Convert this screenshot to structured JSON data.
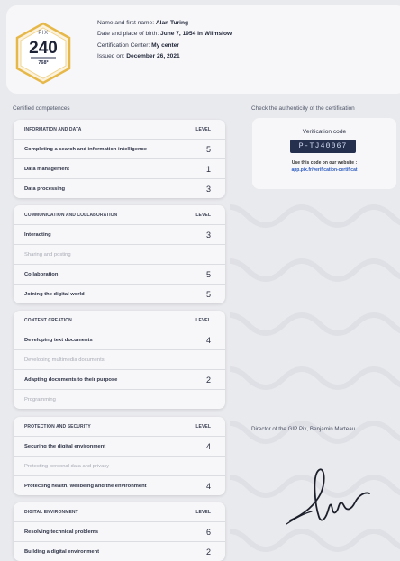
{
  "badge": {
    "brand": "PIX",
    "score": "240",
    "max": "768*"
  },
  "identity": [
    {
      "label": "Name and first name:",
      "value": "Alan Turing"
    },
    {
      "label": "Date and place of birth:",
      "value": "June 7, 1954 in Wilmslow"
    },
    {
      "label": "Certification Center:",
      "value": "My center"
    },
    {
      "label": "Issued on:",
      "value": "December 26, 2021"
    }
  ],
  "competences_title": "Certified competences",
  "authenticity_title": "Check the authenticity of the certification",
  "verification": {
    "title": "Verification code",
    "code": "P-TJ40067",
    "note": "Use this code on our website :",
    "url": "app.pix.fr/verification-certificat"
  },
  "level_label": "LEVEL",
  "groups": [
    {
      "title": "INFORMATION AND DATA",
      "rows": [
        {
          "name": "Completing a search and information intelligence",
          "level": "5"
        },
        {
          "name": "Data management",
          "level": "1"
        },
        {
          "name": "Data processing",
          "level": "3"
        }
      ]
    },
    {
      "title": "COMMUNICATION AND COLLABORATION",
      "rows": [
        {
          "name": "Interacting",
          "level": "3"
        },
        {
          "name": "Sharing and posting",
          "level": ""
        },
        {
          "name": "Collaboration",
          "level": "5"
        },
        {
          "name": "Joining the digital world",
          "level": "5"
        }
      ]
    },
    {
      "title": "CONTENT CREATION",
      "rows": [
        {
          "name": "Developing text documents",
          "level": "4"
        },
        {
          "name": "Developing multimedia documents",
          "level": ""
        },
        {
          "name": "Adapting documents to their purpose",
          "level": "2"
        },
        {
          "name": "Programming",
          "level": ""
        }
      ]
    },
    {
      "title": "PROTECTION AND SECURITY",
      "rows": [
        {
          "name": "Securing the digital environment",
          "level": "4"
        },
        {
          "name": "Protecting personal data and privacy",
          "level": ""
        },
        {
          "name": "Protecting health, wellbeing and the environment",
          "level": "4"
        }
      ]
    },
    {
      "title": "DIGITAL ENVIRONMENT",
      "rows": [
        {
          "name": "Resolving technical problems",
          "level": "6"
        },
        {
          "name": "Building a digital environment",
          "level": "2"
        }
      ]
    }
  ],
  "director": "Director of the GIP Pix, Benjamin Marteau"
}
